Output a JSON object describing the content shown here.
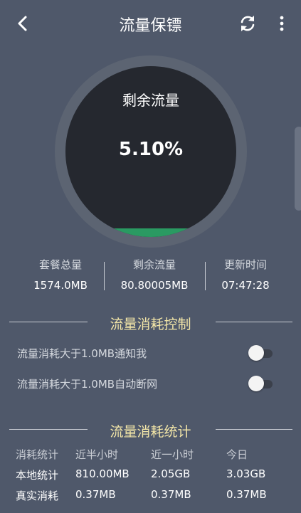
{
  "header": {
    "title": "流量保镖",
    "back_icon": "back-arrow-icon",
    "refresh_icon": "refresh-icon",
    "more_icon": "more-vertical-icon"
  },
  "gauge": {
    "label": "剩余流量",
    "value_text": "5.10%",
    "fill_fraction": 0.051,
    "fill_color": "#2a9a62"
  },
  "summary": {
    "items": [
      {
        "label": "套餐总量",
        "value": "1574.0MB"
      },
      {
        "label": "剩余流量",
        "value": "80.80005MB"
      },
      {
        "label": "更新时间",
        "value": "07:47:28"
      }
    ]
  },
  "control": {
    "heading": "流量消耗控制",
    "toggles": [
      {
        "label": "流量消耗大于1.0MB通知我",
        "on": false
      },
      {
        "label": "流量消耗大于1.0MB自动断网",
        "on": false
      }
    ]
  },
  "stats": {
    "heading": "流量消耗统计",
    "columns": [
      "消耗统计",
      "近半小时",
      "近一小时",
      "今日"
    ],
    "rows": [
      {
        "label": "本地统计",
        "values": [
          "810.00MB",
          "2.05GB",
          "3.03GB"
        ]
      },
      {
        "label": "真实消耗",
        "values": [
          "0.37MB",
          "0.37MB",
          "0.37MB"
        ]
      }
    ]
  },
  "colors": {
    "background": "#4f586a",
    "accent_heading": "#f3e6a8",
    "gauge_dark": "#25282f"
  }
}
